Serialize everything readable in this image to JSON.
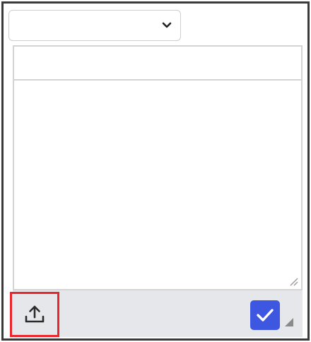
{
  "dropdown": {
    "selected_value": "",
    "icon": "chevron-down-icon"
  },
  "editor": {
    "subject_value": "",
    "body_value": ""
  },
  "toolbar": {
    "upload_icon": "upload-icon",
    "confirm_icon": "checkmark-icon"
  },
  "colors": {
    "highlight_border": "#e8262c",
    "confirm_button": "#3d57e0",
    "toolbar_bg": "#e6e7eb",
    "frame_border": "#3a3a3a"
  }
}
